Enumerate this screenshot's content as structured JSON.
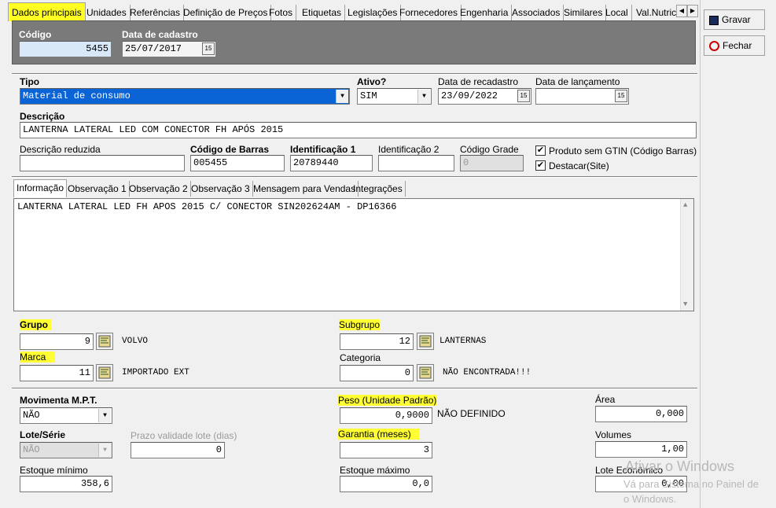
{
  "tabs": [
    "Dados principais",
    "Unidades",
    "Referências",
    "Definição de Preços",
    "Fotos",
    "Etiquetas",
    "Legislações",
    "Fornecedores",
    "Engenharia",
    "Associados",
    "Similares",
    "Local",
    "Val.Nutric"
  ],
  "header": {
    "codigo_label": "Código",
    "codigo_value": "5455",
    "data_cadastro_label": "Data de cadastro",
    "data_cadastro_value": "25/07/2017"
  },
  "sidebar": {
    "gravar_label": "Gravar",
    "fechar_label": "Fechar"
  },
  "form": {
    "tipo_label": "Tipo",
    "tipo_value": "Material de consumo",
    "ativo_label": "Ativo?",
    "ativo_value": "SIM",
    "recadastro_label": "Data de recadastro",
    "recadastro_value": "23/09/2022",
    "lancamento_label": "Data de lançamento",
    "lancamento_value": "  /  /",
    "descricao_label": "Descrição",
    "descricao_value": "LANTERNA LATERAL LED COM CONECTOR FH APÓS 2015",
    "desc_reduzida_label": "Descrição reduzida",
    "desc_reduzida_value": "",
    "codigo_barras_label": "Código de Barras",
    "codigo_barras_value": "005455",
    "ident1_label": "Identificação 1",
    "ident1_value": "20789440",
    "ident2_label": "Identificação 2",
    "ident2_value": "",
    "codigo_grade_label": "Código Grade",
    "codigo_grade_value": "0",
    "sem_gtin_label": "Produto sem GTIN (Código Barras)",
    "sem_gtin_checked": true,
    "destacar_label": "Destacar(Site)",
    "destacar_checked": true
  },
  "inner_tabs": [
    "Informação",
    "Observação 1",
    "Observação 2",
    "Observação 3",
    "Mensagem para Vendas",
    "Integrações"
  ],
  "memo_text": "LANTERNA LATERAL LED FH APOS 2015 C/ CONECTOR SIN202624AM - DP16366",
  "grupo": {
    "label": "Grupo",
    "value": "9",
    "desc": "VOLVO"
  },
  "subgrupo": {
    "label": "Subgrupo",
    "value": "12",
    "desc": "LANTERNAS"
  },
  "marca": {
    "label": "Marca",
    "value": "11",
    "desc": "IMPORTADO EXT"
  },
  "categoria": {
    "label": "Categoria",
    "value": "0",
    "desc": "NÃO ENCONTRADA!!!"
  },
  "bottom": {
    "movimenta_label": "Movimenta M.P.T.",
    "movimenta_value": "NÃO",
    "peso_label": "Peso (Unidade Padrão)",
    "peso_value": "0,9000",
    "peso_desc": "NÃO DEFINIDO",
    "area_label": "Área",
    "area_value": "0,000",
    "lote_label": "Lote/Série",
    "lote_value": "NÃO",
    "prazo_label": "Prazo validade lote (dias)",
    "prazo_value": "0",
    "garantia_label": "Garantia (meses)",
    "garantia_value": "3",
    "volumes_label": "Volumes",
    "volumes_value": "1,00",
    "estoque_min_label": "Estoque mínimo",
    "estoque_min_value": "358,6",
    "estoque_max_label": "Estoque máximo",
    "estoque_max_value": "0,0",
    "lote_economico_label": "Lote Econômico",
    "lote_economico_value": "0,00"
  },
  "watermark": {
    "line1": "Ativar o Windows",
    "line2": "Vá para Sistema no Painel de",
    "line3": "o Windows."
  }
}
